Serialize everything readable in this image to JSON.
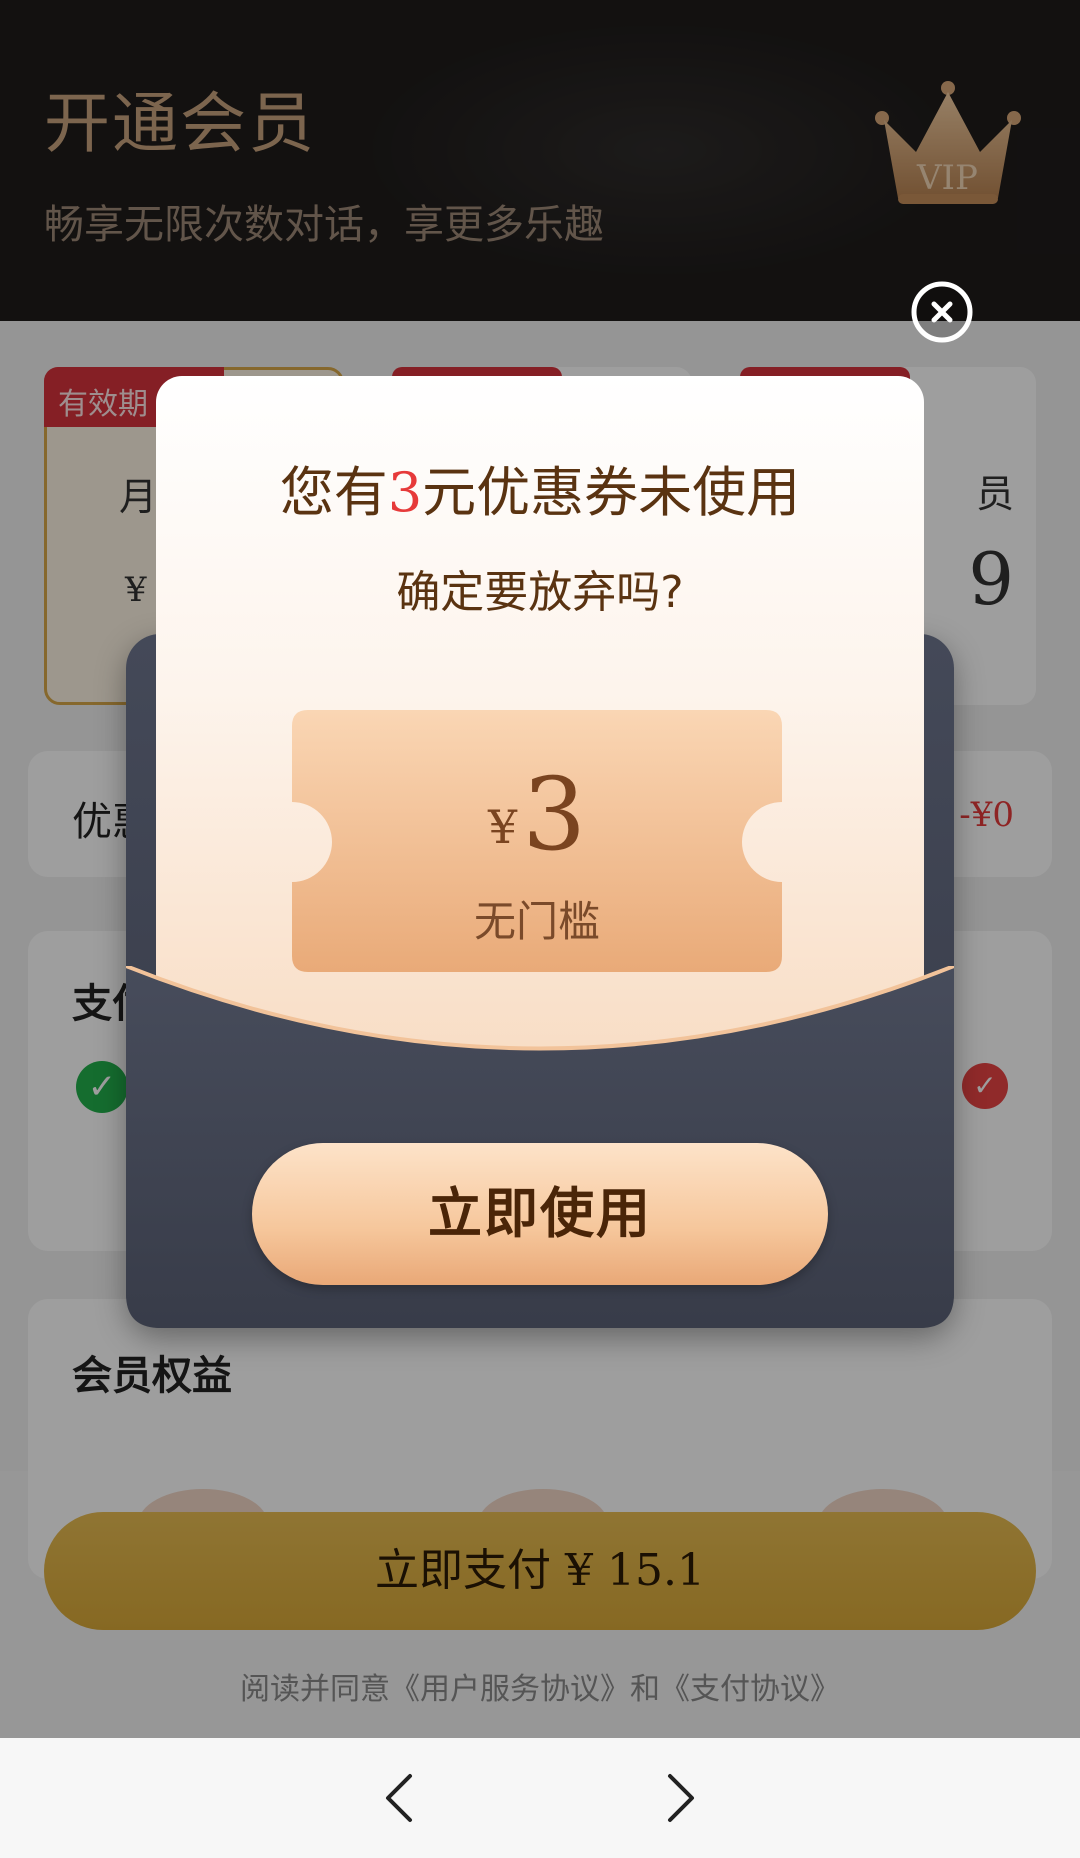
{
  "header": {
    "title": "开通会员",
    "subtitle": "畅享无限次数对话，享更多乐趣",
    "crown_text": "VIP"
  },
  "plans": [
    {
      "tag": "有效期",
      "name": "月",
      "price": "¥"
    },
    {
      "tag": "",
      "name": "",
      "price": ""
    },
    {
      "tag": "",
      "name": "员",
      "price": "9"
    }
  ],
  "discount": {
    "label": "优惠",
    "value": "-¥0"
  },
  "payment": {
    "label": "支付"
  },
  "rights": {
    "label": "会员权益"
  },
  "pay_button": {
    "prefix": "立即支付 ",
    "amount": "¥ 15.1"
  },
  "agreement": "阅读并同意《用户服务协议》和《支付协议》",
  "modal": {
    "title_before": "您有",
    "title_highlight": "3",
    "title_after": "元优惠券未使用",
    "subtitle": "确定要放弃吗?",
    "coupon": {
      "currency": "¥",
      "amount": "3",
      "desc": "无门槛"
    },
    "use_button": "立即使用"
  },
  "colors": {
    "accent_red": "#e63a3a",
    "gold": "#d9a938",
    "modal_brown": "#5a3311",
    "envelope": "#3d414f"
  },
  "icons": [
    "crown-icon",
    "close-icon",
    "wechat-pay-icon",
    "check-icon",
    "back-arrow-icon",
    "forward-arrow-icon"
  ]
}
